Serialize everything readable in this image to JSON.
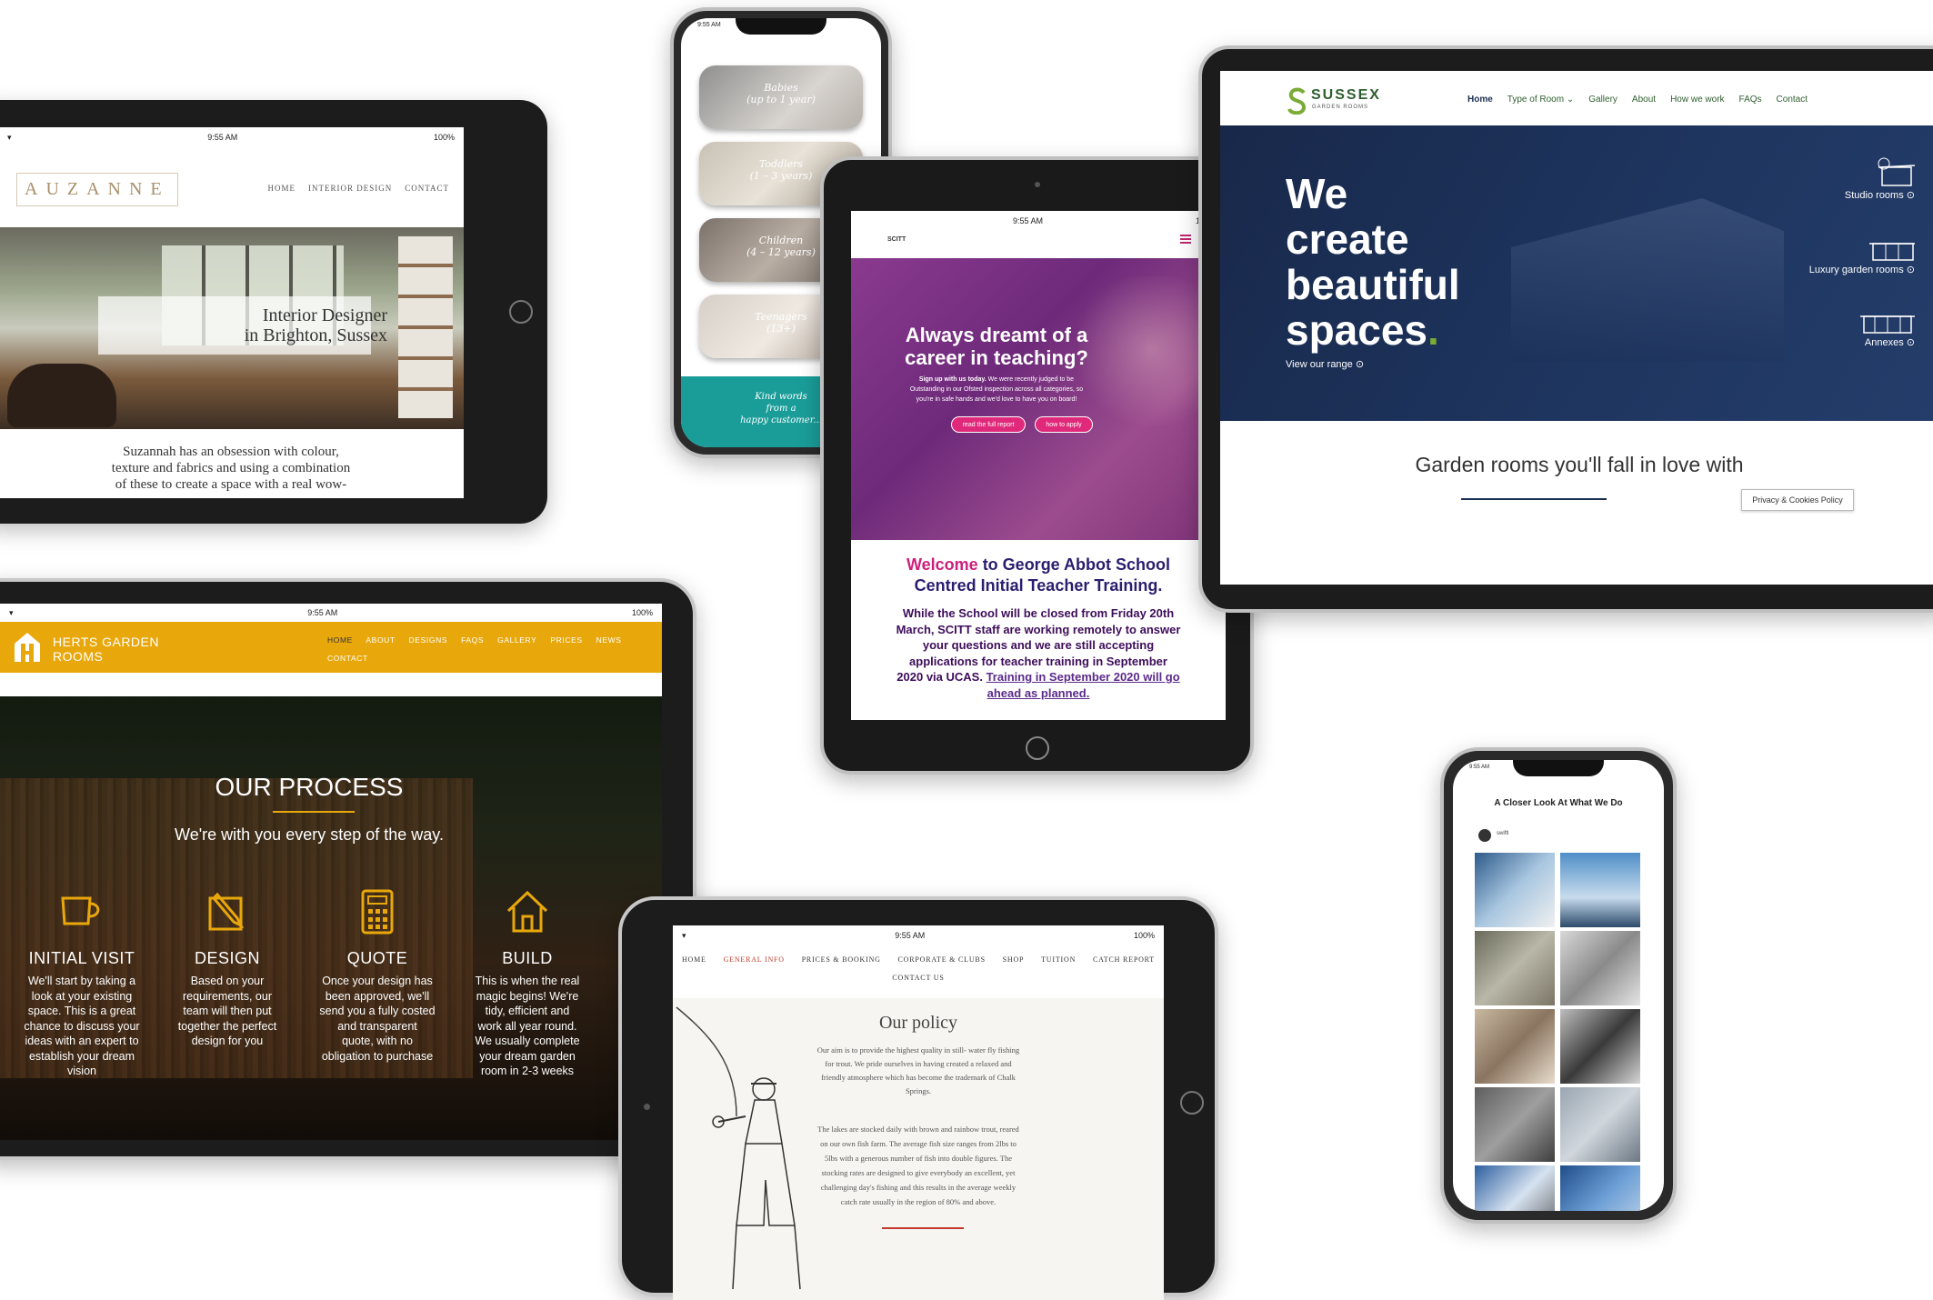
{
  "status": {
    "time": "9:55 AM",
    "battery": "100%"
  },
  "suzanne": {
    "logo": "AUZANNE",
    "nav": [
      "HOME",
      "INTERIOR DESIGN",
      "CONTACT"
    ],
    "hero_title_1": "Interior Designer",
    "hero_title_2": "in Brighton, Sussex",
    "intro_1": "Suzannah has an obsession with colour,",
    "intro_2": "texture and fabrics and using a combination",
    "intro_3": "of these to create a space with a real wow-"
  },
  "nursery": {
    "cards": [
      {
        "line1": "Babies",
        "line2": "(up to 1 year)"
      },
      {
        "line1": "Toddlers",
        "line2": "(1 – 3 years)"
      },
      {
        "line1": "Children",
        "line2": "(4 – 12 years)"
      },
      {
        "line1": "Teenagers",
        "line2": "(13+)"
      }
    ],
    "footer_1": "Kind words",
    "footer_2": "from a",
    "footer_3": "happy customer...",
    "accent": "#1a9d99"
  },
  "teacher": {
    "logo": "SCITT",
    "hero_title_1": "Always dreamt of a",
    "hero_title_2": "career in teaching?",
    "hero_sub_bold": "Sign up with us today.",
    "hero_sub_1": " We were recently judged to be",
    "hero_sub_2": "Outstanding in our Ofsted inspection across all categories, so",
    "hero_sub_3": "you're in safe hands and we'd love to have you on board!",
    "btn_report": "read the full report",
    "btn_apply": "how to apply",
    "welcome_word": "Welcome",
    "welcome_rest": " to George Abbot School",
    "welcome_line2": "Centred Initial Teacher Training.",
    "body_1": "While the School will be closed from Friday 20th",
    "body_2": "March, SCITT staff are working remotely to answer",
    "body_3": "your questions and we are still accepting",
    "body_4": "applications for teacher training in September",
    "body_5": "2020 via UCAS.",
    "body_link_1": "Training in September 2020 will go",
    "body_link_2": "ahead as planned.",
    "accent": "#cc1f7a",
    "hero_color": "#7b2c83"
  },
  "sussex": {
    "logo_name": "SUSSEX",
    "logo_sub": "GARDEN ROOMS",
    "nav": [
      "Home",
      "Type of Room",
      "Gallery",
      "About",
      "How we work",
      "FAQs",
      "Contact"
    ],
    "hero_1": "We",
    "hero_2": "create",
    "hero_3": "beautiful",
    "hero_4": "spaces",
    "hero_dot": ".",
    "view_range": "View our range",
    "types": [
      "Studio rooms",
      "Luxury garden rooms",
      "Annexes"
    ],
    "tagline": "Garden rooms you'll fall in love with",
    "cookies": "Privacy & Cookies Policy",
    "accent": "#7aab36",
    "hero_color": "#1b2f55"
  },
  "herts": {
    "logo_1": "HERTS GARDEN",
    "logo_2": "ROOMS",
    "nav": [
      "HOME",
      "ABOUT",
      "DESIGNS",
      "FAQS",
      "GALLERY",
      "PRICES",
      "NEWS",
      "CONTACT"
    ],
    "title": "OUR PROCESS",
    "subtitle": "We're with you every step of the way.",
    "steps": [
      {
        "title": "INITIAL VISIT",
        "lines": [
          "We'll start by taking a",
          "look at your existing",
          "space. This is a great",
          "chance to discuss your",
          "ideas with an expert to",
          "establish your dream",
          "vision"
        ]
      },
      {
        "title": "DESIGN",
        "lines": [
          "Based on your",
          "requirements, our",
          "team will then put",
          "together the perfect",
          "design for you"
        ]
      },
      {
        "title": "QUOTE",
        "lines": [
          "Once your design has",
          "been approved, we'll",
          "send you a fully costed",
          "and transparent",
          "quote, with no",
          "obligation to purchase"
        ]
      },
      {
        "title": "BUILD",
        "lines": [
          "This is when the real",
          "magic begins! We're",
          "tidy, efficient and",
          "work all year round.",
          "We usually complete",
          "your dream garden",
          "room in 2-3 weeks"
        ]
      }
    ],
    "accent": "#e8a80c"
  },
  "fishing": {
    "nav": [
      "HOME",
      "GENERAL INFO",
      "PRICES & BOOKING",
      "CORPORATE & CLUBS",
      "SHOP",
      "TUITION",
      "CATCH REPORT",
      "CONTACT US"
    ],
    "title": "Our policy",
    "p1": [
      "Our aim is to provide the highest quality in still- water fly fishing",
      "for trout. We pride ourselves in having created a relaxed and",
      "friendly atmosphere which has become the trademark of Chalk",
      "Springs."
    ],
    "p2": [
      "The lakes are stocked daily with brown and rainbow trout, reared",
      "on our own fish farm. The average fish size ranges from 2lbs to",
      "5lbs with a generous number of fish into double figures. The",
      "stocking rates are designed to give everybody an excellent, yet",
      "challenging day's fishing and this results in the average weekly",
      "catch rate usually in the region of 80% and above."
    ],
    "accent": "#c0392b"
  },
  "feed": {
    "title": "A Closer Look At What We Do",
    "handle": "swiftl"
  }
}
